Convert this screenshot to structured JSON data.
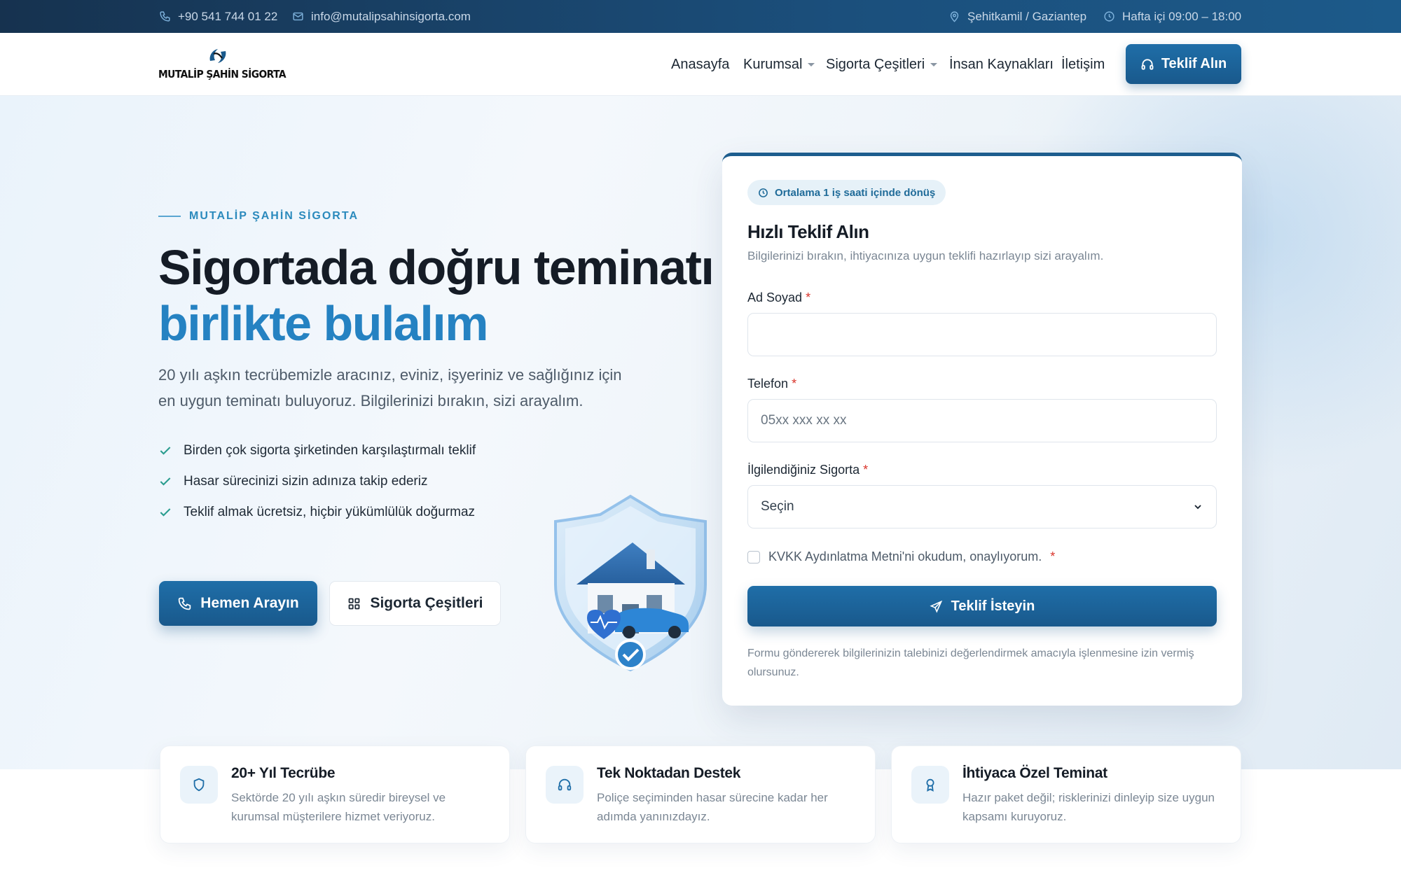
{
  "topbar": {
    "phone": "+90 541 744 01 22",
    "email": "info@mutalipsahinsigorta.com",
    "location": "Şehitkamil / Gaziantep",
    "hours": "Hafta içi 09:00 – 18:00"
  },
  "brand": {
    "name": "MUTALİP ŞAHİN SİGORTA"
  },
  "nav": {
    "items": [
      "Anasayfa",
      "Kurumsal",
      "Sigorta Çeşitleri",
      "İnsan Kaynakları",
      "İletişim"
    ],
    "cta": "Teklif Alın"
  },
  "hero": {
    "eyebrow": "MUTALİP ŞAHİN SİGORTA",
    "title_line1": "Sigortada doğru teminatı",
    "title_line2": "birlikte bulalım",
    "lead": "20 yılı aşkın tecrübemizle aracınız, eviniz, işyeriniz ve sağlığınız için en uygun teminatı buluyoruz. Bilgilerinizi bırakın, sizi arayalım.",
    "checks": [
      "Birden çok sigorta şirketinden karşılaştırmalı teklif",
      "Hasar sürecinizi sizin adınıza takip ederiz",
      "Teklif almak ücretsiz, hiçbir yükümlülük doğurmaz"
    ],
    "cta_primary": "Hemen Arayın",
    "cta_secondary": "Sigorta Çeşitleri"
  },
  "form": {
    "badge": "Ortalama 1 iş saati içinde dönüş",
    "title": "Hızlı Teklif Alın",
    "subtitle": "Bilgilerinizi bırakın, ihtiyacınıza uygun teklifi hazırlayıp sizi arayalım.",
    "name_label": "Ad Soyad",
    "name_value": "",
    "phone_label": "Telefon",
    "phone_placeholder": "05xx xxx xx xx",
    "insurance_label": "İlgilendiğiniz Sigorta",
    "insurance_selected": "Seçin",
    "required_mark": "*",
    "kvkk": "KVKK Aydınlatma Metni'ni okudum, onaylıyorum.",
    "submit": "Teklif İsteyin",
    "disclaimer": "Formu göndererek bilgilerinizin talebinizi değerlendirmek amacıyla işlenmesine izin vermiş olursunuz."
  },
  "features": [
    {
      "icon": "shield-icon",
      "title": "20+ Yıl Tecrübe",
      "desc": "Sektörde 20 yılı aşkın süredir bireysel ve kurumsal müşterilere hizmet veriyoruz."
    },
    {
      "icon": "headset-icon",
      "title": "Tek Noktadan Destek",
      "desc": "Poliçe seçiminden hasar sürecine kadar her adımda yanınızdayız."
    },
    {
      "icon": "award-icon",
      "title": "İhtiyaca Özel Teminat",
      "desc": "Hazır paket değil; risklerinizi dinleyip size uygun kapsamı kuruyoruz."
    }
  ],
  "colors": {
    "primary": "#1f6ea8",
    "accent": "#2582c2",
    "topbar": "#16324f",
    "required": "#d9342b"
  }
}
